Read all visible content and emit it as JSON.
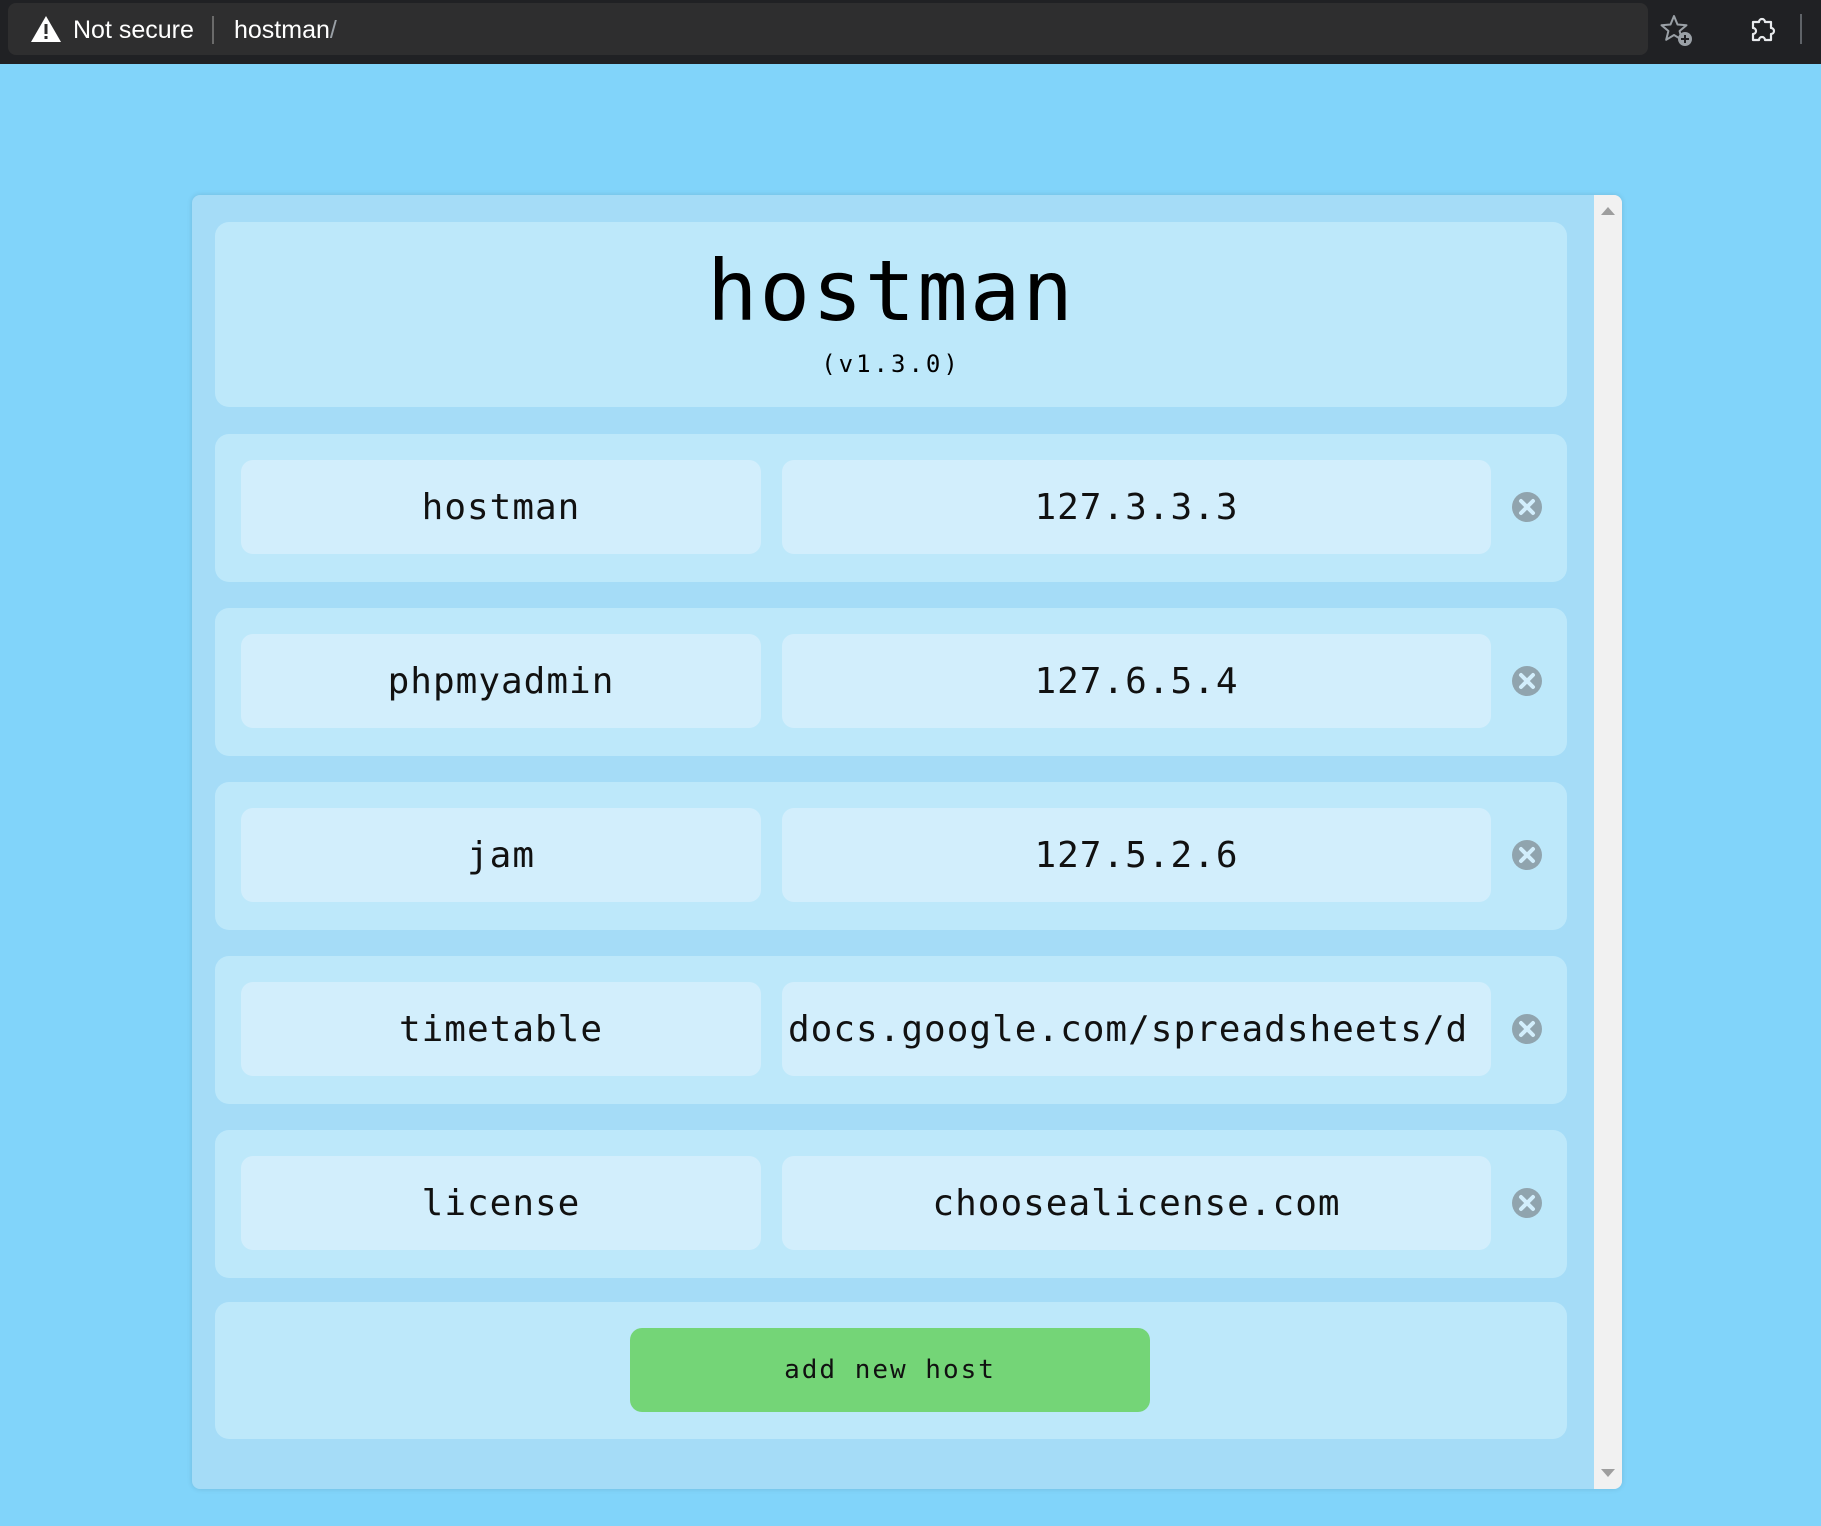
{
  "browser": {
    "security_label": "Not secure",
    "url": "hostman",
    "url_suffix": "/"
  },
  "app": {
    "title": "hostman",
    "version": "(v1.3.0)"
  },
  "hosts": [
    {
      "name": "hostman",
      "address": "127.3.3.3"
    },
    {
      "name": "phpmyadmin",
      "address": "127.6.5.4"
    },
    {
      "name": "jam",
      "address": "127.5.2.6"
    },
    {
      "name": "timetable",
      "address": "docs.google.com/spreadsheets/d"
    },
    {
      "name": "license",
      "address": "choosealicense.com"
    }
  ],
  "add_button_label": "add new host",
  "colors": {
    "page_background": "#81d4fa",
    "card": "#bde8fa",
    "field": "#d2eefc",
    "add_button": "#74d577"
  }
}
